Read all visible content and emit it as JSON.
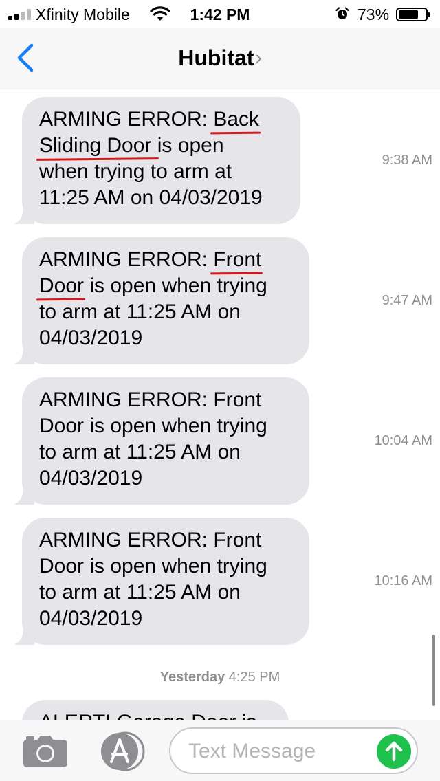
{
  "status_bar": {
    "carrier": "Xfinity Mobile",
    "time": "1:42 PM",
    "battery": "73%",
    "battery_level": 0.73
  },
  "header": {
    "contact": "Hubitat",
    "chevron": "›"
  },
  "messages": [
    {
      "parts": [
        "ARMING ERROR: ",
        "Back",
        "\n",
        "Sliding Door ",
        "is open",
        "\n",
        "when trying to arm at",
        "\n",
        "11:25 AM on 04/03/2019"
      ],
      "time": "9:38 AM"
    },
    {
      "parts": [
        "ARMING ERROR: ",
        "Front",
        "\n",
        "Door",
        " is open when trying",
        "\n",
        "to arm at 11:25 AM on",
        "\n",
        "04/03/2019"
      ],
      "time": "9:47 AM"
    },
    {
      "text_lines": [
        "ARMING ERROR: Front",
        "Door is open when trying",
        "to arm at 11:25 AM on",
        "04/03/2019"
      ],
      "time": "10:04 AM"
    },
    {
      "text_lines": [
        "ARMING ERROR: Front",
        "Door is open when trying",
        "to arm at 11:25 AM on",
        "04/03/2019"
      ],
      "time": "10:16 AM"
    }
  ],
  "day_separator": {
    "day": "Yesterday",
    "time": "4:25 PM"
  },
  "partial_message": "ALERT! Garage Door is",
  "composer": {
    "placeholder": "Text Message"
  },
  "colors": {
    "accent": "#147efb",
    "bubble": "#e5e5ea",
    "send": "#1fc14d",
    "annotation": "#d21a1a"
  }
}
